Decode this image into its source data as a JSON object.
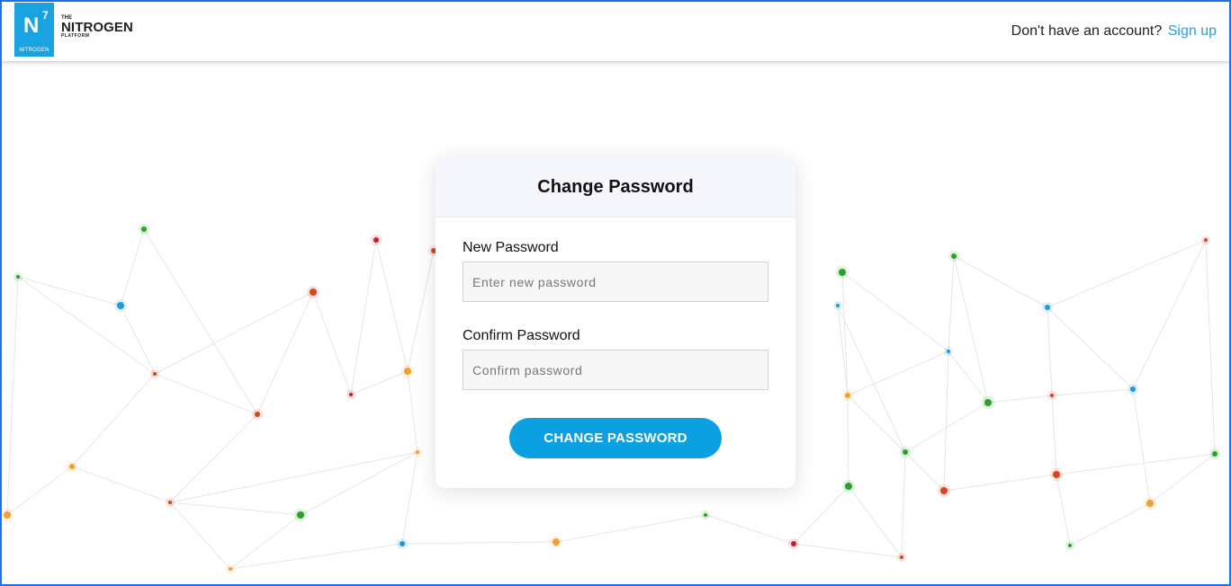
{
  "header": {
    "logo": {
      "big_letter": "N",
      "superscript": "7",
      "small_label": "NITROGEN",
      "the": "THE",
      "name": "NITROGEN",
      "platform": "PLATFORM"
    },
    "signup_prompt": "Don't have an account?",
    "signup_link": "Sign up"
  },
  "form": {
    "title": "Change Password",
    "new_password": {
      "label": "New Password",
      "placeholder": "Enter new password",
      "value": ""
    },
    "confirm_password": {
      "label": "Confirm Password",
      "placeholder": "Confirm password",
      "value": ""
    },
    "submit_label": "CHANGE PASSWORD"
  },
  "colors": {
    "accent": "#0ba1e0",
    "link": "#2a9fd6",
    "frame_border": "#1a73e8",
    "node_colors": [
      "#2ca02c",
      "#1f9ad6",
      "#d6461f",
      "#f0a030",
      "#c0202a"
    ]
  },
  "icons": {
    "background": "network-graph-pattern"
  }
}
